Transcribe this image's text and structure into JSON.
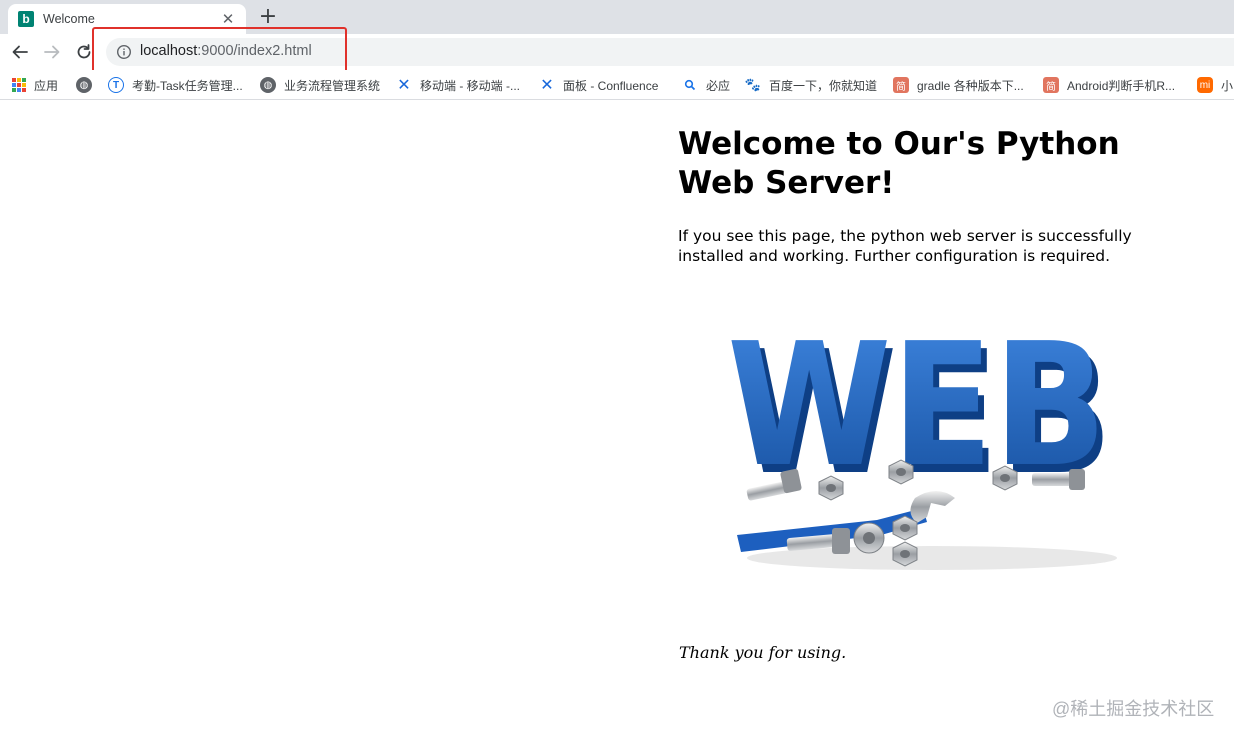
{
  "tab": {
    "title": "Welcome",
    "favicon": "bing-icon"
  },
  "toolbar": {
    "url_host": "localhost",
    "url_rest": ":9000/index2.html"
  },
  "bookmarks": [
    {
      "label": "应用",
      "icon": "apps-grid-icon"
    },
    {
      "label": "",
      "icon": "globe-icon"
    },
    {
      "label": "考勤-Task任务管理...",
      "icon": "t-circle-icon"
    },
    {
      "label": "业务流程管理系统",
      "icon": "globe-icon"
    },
    {
      "label": "移动端 - 移动端 -...",
      "icon": "confluence-icon"
    },
    {
      "label": "面板 - Confluence",
      "icon": "confluence-icon"
    },
    {
      "label": "必应",
      "icon": "search-icon"
    },
    {
      "label": "百度一下，你就知道",
      "icon": "baidu-paw-icon"
    },
    {
      "label": "gradle 各种版本下...",
      "icon": "jianshu-icon"
    },
    {
      "label": "Android判断手机R...",
      "icon": "jianshu-icon"
    },
    {
      "label": "小",
      "icon": "mi-icon"
    }
  ],
  "page": {
    "heading": "Welcome to Our's Python Web Server!",
    "intro": "If you see this page, the python web server is successfully installed and working. Further configuration is required.",
    "art_text": "WEB",
    "thanks": "Thank you for using."
  },
  "watermark": "@稀土掘金技术社区",
  "colors": {
    "highlight": "#e0312b",
    "web_blue": "#1d5fbf",
    "confluence_blue": "#1868db"
  }
}
